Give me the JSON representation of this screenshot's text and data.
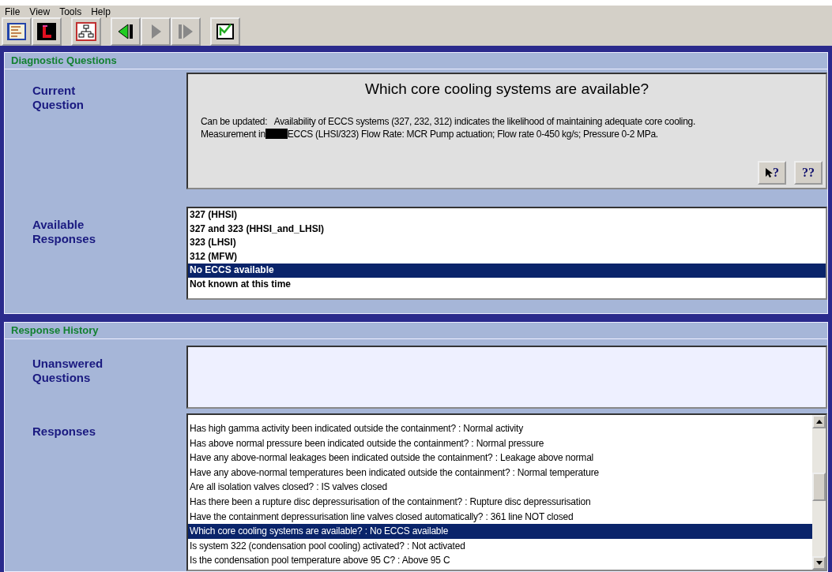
{
  "menu": [
    "File",
    "View",
    "Tools",
    "Help"
  ],
  "toolbar": [
    {
      "kind": "list"
    },
    {
      "kind": "stop"
    },
    {
      "kind": "tree"
    },
    {
      "kind": "back",
      "disabled": false
    },
    {
      "kind": "forward",
      "disabled": true
    },
    {
      "kind": "end",
      "disabled": true
    },
    {
      "kind": "check"
    }
  ],
  "diagnostic": {
    "title": "Diagnostic Questions",
    "question_label": "Current Question",
    "question": "Which core cooling systems are available?",
    "description_line1": "Can be updated:   Availability of ECCS systems (327, 232, 312) indicates the likelihood of maintaining adequate core cooling.",
    "description_line2_before": "Measurement in",
    "description_line2_after": "ECCS (LHSI/323) Flow Rate: MCR Pump actuation; Flow rate 0-450 kg/s; Pressure 0-2 MPa.",
    "help_buttons": [
      "?",
      "??"
    ],
    "responses_label": "Available Responses",
    "responses": [
      {
        "label": "327 (HHSI)",
        "selected": false
      },
      {
        "label": "327 and 323 (HHSI_and_LHSI)",
        "selected": false
      },
      {
        "label": "323 (LHSI)",
        "selected": false
      },
      {
        "label": "312 (MFW)",
        "selected": false
      },
      {
        "label": "No ECCS available",
        "selected": true
      },
      {
        "label": "Not known at this time",
        "selected": false
      }
    ]
  },
  "history": {
    "title": "Response History",
    "unanswered_label": "Unanswered Questions",
    "responses_label": "Responses",
    "responses": [
      {
        "label": "Has high gamma activity been indicated outside the containment? : Normal activity",
        "selected": false
      },
      {
        "label": "Has above normal pressure been indicated outside the containment? : Normal pressure",
        "selected": false
      },
      {
        "label": "Have any above-normal leakages been indicated outside the containment? : Leakage above normal",
        "selected": false
      },
      {
        "label": "Have any above-normal temperatures been indicated outside the containment? : Normal temperature",
        "selected": false
      },
      {
        "label": "Are all isolation valves closed? : IS valves closed",
        "selected": false
      },
      {
        "label": "Has there been a rupture disc depressurisation of the containment? : Rupture disc depressurisation",
        "selected": false
      },
      {
        "label": "Have the containment depressurisation line valves closed automatically? : 361 line NOT closed",
        "selected": false
      },
      {
        "label": "Which core cooling systems are available? : No ECCS available",
        "selected": true
      },
      {
        "label": "Is system 322 (condensation pool cooling) activated? : Not activated",
        "selected": false
      },
      {
        "label": "Is the condensation pool temperature above 95 C? : Above 95 C",
        "selected": false
      }
    ]
  }
}
